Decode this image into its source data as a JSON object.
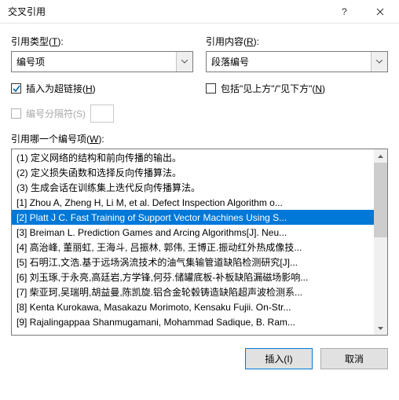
{
  "window": {
    "title": "交叉引用"
  },
  "fields": {
    "ref_type_label_pre": "引用类型(",
    "ref_type_label_u": "T",
    "ref_type_label_post": "):",
    "ref_type_value": "编号项",
    "ref_content_label_pre": "引用内容(",
    "ref_content_label_u": "R",
    "ref_content_label_post": "):",
    "ref_content_value": "段落编号",
    "hyperlink_label_pre": "插入为超链接(",
    "hyperlink_label_u": "H",
    "hyperlink_label_post": ")",
    "include_label_pre": "包括\"见上方\"/\"见下方\"(",
    "include_label_u": "N",
    "include_label_post": ")",
    "separator_label_pre": "编号分隔符(",
    "separator_label_u": "S",
    "separator_label_post": ")",
    "list_label_pre": "引用哪一个编号项(",
    "list_label_u": "W",
    "list_label_post": "):"
  },
  "list": {
    "selected_index": 4,
    "items": [
      "(1)   定义网络的结构和前向传播的输出。",
      "(2)   定义损失函数和选择反向传播算法。",
      "(3)   生成会话在训练集上迭代反向传播算法。",
      "[1] Zhou A, Zheng H, Li M, et al. Defect Inspection Algorithm o...",
      "[2] Platt J C. Fast Training of Support Vector Machines Using S...",
      "[3] Breiman L. Prediction Games and Arcing Algorithms[J]. Neu...",
      "[4] 高治峰, 董丽虹, 王海斗, 吕振林, 郭伟, 王博正.振动红外热成像技...",
      "[5] 石明江,文浩.基于远场涡流技术的油气集输管道缺陷检测研究[J]...",
      "[6] 刘玉琢,于永亮,高廷岩,方学锋,何芬.储罐底板-补板缺陷漏磁场影响...",
      "[7] 柴亚珂,吴瑞明,胡益曼,陈凯旋.铝合金轮毂铸造缺陷超声波检测系...",
      "[8] Kenta Kurokawa, Masakazu Morimoto, Kensaku Fujii. On-Str...",
      "[9] Rajalingappaa Shanmugamani, Mohammad Sadique, B. Ram..."
    ]
  },
  "buttons": {
    "insert": "插入(I)",
    "cancel": "取消"
  }
}
